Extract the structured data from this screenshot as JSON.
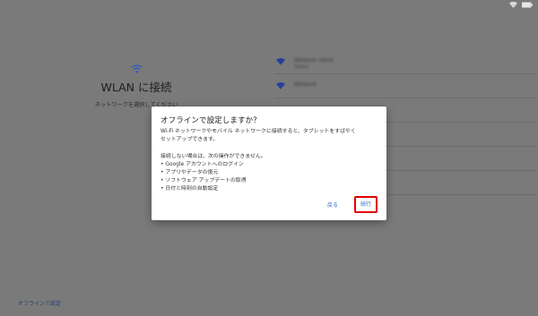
{
  "status_bar": {
    "icons": [
      "wifi-status-icon",
      "battery-icon"
    ]
  },
  "setup": {
    "title": "WLAN に接続",
    "subtitle": "ネットワークを選択してください",
    "offline_link": "オフラインで設定"
  },
  "networks": [
    {
      "name": "Network name",
      "status": "Status"
    },
    {
      "name": "Network",
      "status": ""
    },
    {
      "name": "",
      "status": ""
    },
    {
      "name": "",
      "status": ""
    },
    {
      "name": "",
      "status": ""
    },
    {
      "name": "",
      "status": ""
    }
  ],
  "dialog": {
    "title": "オフラインで設定しますか？",
    "body_line1": "Wi-Fi ネットワークやモバイル ネットワークに接続すると、タブレットをすばやく",
    "body_line2": "セットアップできます。",
    "note": "接続しない場合は、次の操作ができません。",
    "bullets": [
      "Google アカウントへのログイン",
      "アプリやデータの復元",
      "ソフトウェア アップデートの取得",
      "日付と時刻の自動設定"
    ],
    "back_label": "戻る",
    "continue_label": "続行"
  },
  "colors": {
    "scrim_background": "#7a7a7a",
    "dialog_background": "#ffffff",
    "button_text": "#3467d6",
    "highlight": "#e10000"
  }
}
